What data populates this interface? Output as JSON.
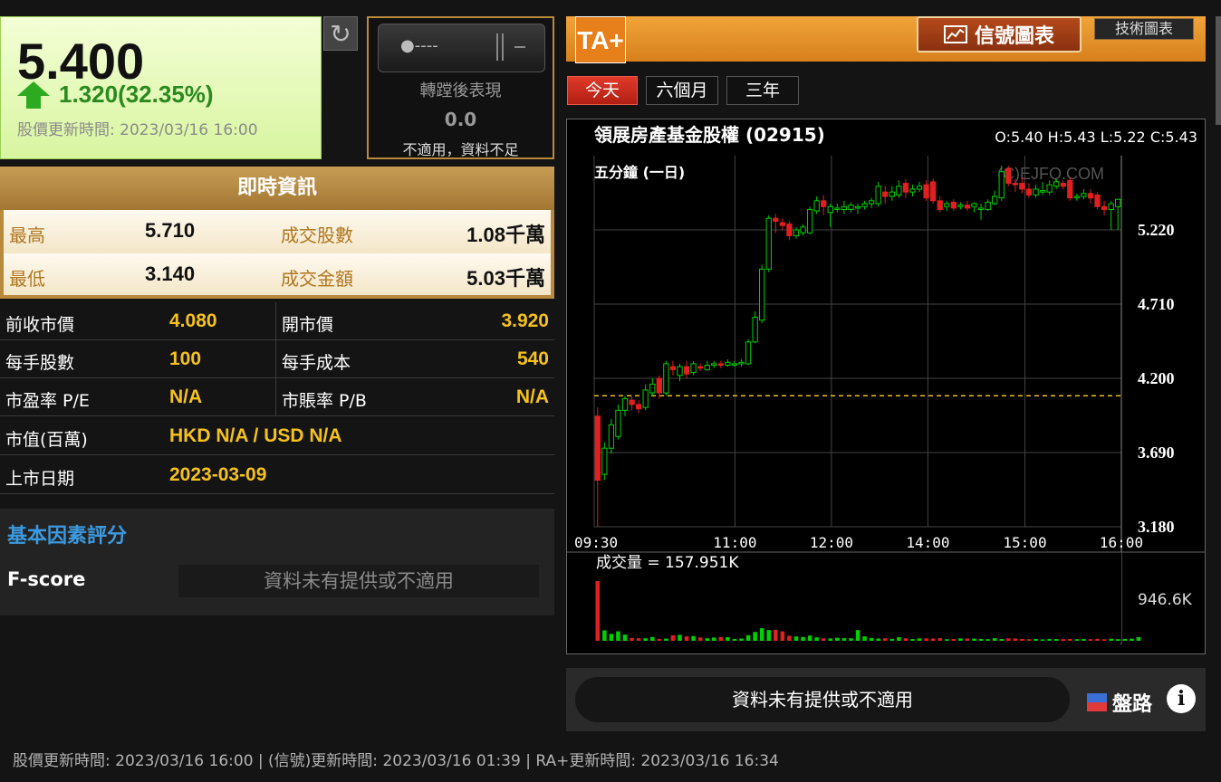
{
  "quote": {
    "price": "5.400",
    "change": "1.320(32.35%)",
    "price_time": "股價更新時間: 2023/03/16 16:00"
  },
  "split": {
    "toggle_label": "●----",
    "label": "轉蹚後表現",
    "value": "0.0",
    "note": "不適用，資料不足"
  },
  "live": {
    "title": "即時資訊",
    "high_label": "最高",
    "high": "5.710",
    "volume_label": "成交股數",
    "volume": "1.08千萬",
    "low_label": "最低",
    "low": "3.140",
    "turnover_label": "成交金額",
    "turnover": "5.03千萬"
  },
  "stats": {
    "prev_close_label": "前收市價",
    "prev_close": "4.080",
    "open_label": "開市價",
    "open": "3.920",
    "lot_label": "每手股數",
    "lot": "100",
    "lot_cost_label": "每手成本",
    "lot_cost": "540",
    "pe_label": "市盈率 P/E",
    "pe": "N/A",
    "pb_label": "市賬率 P/B",
    "pb": "N/A",
    "mcap_label": "市值(百萬)",
    "mcap": "HKD N/A / USD N/A",
    "listing_label": "上市日期",
    "listing": "2023-03-09"
  },
  "fundamental": {
    "title": "基本因素評分",
    "fscore_label": "F-score",
    "fscore_value": "資料未有提供或不適用"
  },
  "ta": {
    "logo": "TA+",
    "signal_button": "信號圖表",
    "tech_button": "技術圖表",
    "tabs": [
      "今天",
      "六個月",
      "三年"
    ]
  },
  "chart_data": {
    "type": "candlestick",
    "title": "領展房產基金股權 (02915)",
    "ohlc_label": "O:5.40 H:5.43 L:5.22 C:5.43",
    "subtitle": "五分鐘 (一日)",
    "watermark": "(C)EJFQ.COM",
    "ylim": [
      3.18,
      5.73
    ],
    "yticks": [
      "5.220",
      "4.710",
      "4.200",
      "3.690",
      "3.180"
    ],
    "xticks": [
      "09:30",
      "11:00",
      "12:00",
      "14:00",
      "15:00",
      "16:00"
    ],
    "prev_close_line": 4.08,
    "candles": [
      {
        "o": 3.94,
        "c": 3.5,
        "h": 4.0,
        "l": 3.18
      },
      {
        "o": 3.54,
        "c": 3.72,
        "h": 3.76,
        "l": 3.5
      },
      {
        "o": 3.72,
        "c": 3.88,
        "h": 3.92,
        "l": 3.68
      },
      {
        "o": 3.8,
        "c": 3.98,
        "h": 4.02,
        "l": 3.78
      },
      {
        "o": 3.98,
        "c": 4.06,
        "h": 4.08,
        "l": 3.94
      },
      {
        "o": 4.05,
        "c": 4.02,
        "h": 4.08,
        "l": 3.98
      },
      {
        "o": 4.02,
        "c": 3.99,
        "h": 4.05,
        "l": 3.96
      },
      {
        "o": 4.0,
        "c": 4.12,
        "h": 4.16,
        "l": 3.98
      },
      {
        "o": 4.1,
        "c": 4.16,
        "h": 4.2,
        "l": 4.08
      },
      {
        "o": 4.2,
        "c": 4.1,
        "h": 4.22,
        "l": 4.06
      },
      {
        "o": 4.1,
        "c": 4.3,
        "h": 4.32,
        "l": 4.08
      },
      {
        "o": 4.28,
        "c": 4.26,
        "h": 4.32,
        "l": 4.22
      },
      {
        "o": 4.22,
        "c": 4.28,
        "h": 4.3,
        "l": 4.18
      },
      {
        "o": 4.28,
        "c": 4.23,
        "h": 4.32,
        "l": 4.2
      },
      {
        "o": 4.24,
        "c": 4.3,
        "h": 4.32,
        "l": 4.22
      },
      {
        "o": 4.28,
        "c": 4.27,
        "h": 4.3,
        "l": 4.25
      },
      {
        "o": 4.26,
        "c": 4.29,
        "h": 4.32,
        "l": 4.25
      },
      {
        "o": 4.29,
        "c": 4.3,
        "h": 4.32,
        "l": 4.27
      },
      {
        "o": 4.3,
        "c": 4.29,
        "h": 4.32,
        "l": 4.27
      },
      {
        "o": 4.29,
        "c": 4.31,
        "h": 4.33,
        "l": 4.28
      },
      {
        "o": 4.3,
        "c": 4.3,
        "h": 4.32,
        "l": 4.28
      },
      {
        "o": 4.3,
        "c": 4.31,
        "h": 4.33,
        "l": 4.28
      },
      {
        "o": 4.3,
        "c": 4.45,
        "h": 4.47,
        "l": 4.29
      },
      {
        "o": 4.45,
        "c": 4.62,
        "h": 4.66,
        "l": 4.44
      },
      {
        "o": 4.6,
        "c": 4.95,
        "h": 4.98,
        "l": 4.58
      },
      {
        "o": 4.95,
        "c": 5.3,
        "h": 5.32,
        "l": 4.93
      },
      {
        "o": 5.3,
        "c": 5.28,
        "h": 5.33,
        "l": 5.2
      },
      {
        "o": 5.27,
        "c": 5.25,
        "h": 5.3,
        "l": 5.22
      },
      {
        "o": 5.26,
        "c": 5.18,
        "h": 5.28,
        "l": 5.15
      },
      {
        "o": 5.18,
        "c": 5.22,
        "h": 5.24,
        "l": 5.16
      },
      {
        "o": 5.2,
        "c": 5.24,
        "h": 5.26,
        "l": 5.18
      },
      {
        "o": 5.2,
        "c": 5.36,
        "h": 5.38,
        "l": 5.19
      },
      {
        "o": 5.35,
        "c": 5.42,
        "h": 5.45,
        "l": 5.33
      },
      {
        "o": 5.42,
        "c": 5.38,
        "h": 5.46,
        "l": 5.32
      },
      {
        "o": 5.34,
        "c": 5.38,
        "h": 5.4,
        "l": 5.24
      },
      {
        "o": 5.36,
        "c": 5.37,
        "h": 5.4,
        "l": 5.34
      },
      {
        "o": 5.36,
        "c": 5.38,
        "h": 5.42,
        "l": 5.33
      },
      {
        "o": 5.36,
        "c": 5.39,
        "h": 5.41,
        "l": 5.34
      },
      {
        "o": 5.37,
        "c": 5.38,
        "h": 5.4,
        "l": 5.33
      },
      {
        "o": 5.38,
        "c": 5.4,
        "h": 5.42,
        "l": 5.36
      },
      {
        "o": 5.4,
        "c": 5.42,
        "h": 5.44,
        "l": 5.37
      },
      {
        "o": 5.4,
        "c": 5.52,
        "h": 5.55,
        "l": 5.38
      },
      {
        "o": 5.48,
        "c": 5.45,
        "h": 5.52,
        "l": 5.4
      },
      {
        "o": 5.45,
        "c": 5.48,
        "h": 5.52,
        "l": 5.42
      },
      {
        "o": 5.46,
        "c": 5.52,
        "h": 5.56,
        "l": 5.44
      },
      {
        "o": 5.54,
        "c": 5.48,
        "h": 5.57,
        "l": 5.44
      },
      {
        "o": 5.48,
        "c": 5.5,
        "h": 5.53,
        "l": 5.45
      },
      {
        "o": 5.5,
        "c": 5.52,
        "h": 5.55,
        "l": 5.48
      },
      {
        "o": 5.53,
        "c": 5.44,
        "h": 5.56,
        "l": 5.42
      },
      {
        "o": 5.55,
        "c": 5.42,
        "h": 5.57,
        "l": 5.4
      },
      {
        "o": 5.42,
        "c": 5.36,
        "h": 5.45,
        "l": 5.34
      },
      {
        "o": 5.38,
        "c": 5.4,
        "h": 5.42,
        "l": 5.35
      },
      {
        "o": 5.41,
        "c": 5.37,
        "h": 5.43,
        "l": 5.35
      },
      {
        "o": 5.38,
        "c": 5.39,
        "h": 5.41,
        "l": 5.36
      },
      {
        "o": 5.39,
        "c": 5.37,
        "h": 5.42,
        "l": 5.35
      },
      {
        "o": 5.38,
        "c": 5.4,
        "h": 5.41,
        "l": 5.34
      },
      {
        "o": 5.36,
        "c": 5.37,
        "h": 5.4,
        "l": 5.29
      },
      {
        "o": 5.36,
        "c": 5.41,
        "h": 5.43,
        "l": 5.35
      },
      {
        "o": 5.4,
        "c": 5.45,
        "h": 5.49,
        "l": 5.39
      },
      {
        "o": 5.44,
        "c": 5.62,
        "h": 5.66,
        "l": 5.42
      },
      {
        "o": 5.64,
        "c": 5.54,
        "h": 5.66,
        "l": 5.52
      },
      {
        "o": 5.54,
        "c": 5.53,
        "h": 5.57,
        "l": 5.48
      },
      {
        "o": 5.54,
        "c": 5.5,
        "h": 5.58,
        "l": 5.47
      },
      {
        "o": 5.5,
        "c": 5.46,
        "h": 5.54,
        "l": 5.44
      },
      {
        "o": 5.46,
        "c": 5.5,
        "h": 5.53,
        "l": 5.44
      },
      {
        "o": 5.48,
        "c": 5.49,
        "h": 5.55,
        "l": 5.46
      },
      {
        "o": 5.48,
        "c": 5.53,
        "h": 5.56,
        "l": 5.46
      },
      {
        "o": 5.52,
        "c": 5.55,
        "h": 5.57,
        "l": 5.5
      },
      {
        "o": 5.54,
        "c": 5.52,
        "h": 5.56,
        "l": 5.5
      },
      {
        "o": 5.56,
        "c": 5.44,
        "h": 5.58,
        "l": 5.42
      },
      {
        "o": 5.44,
        "c": 5.45,
        "h": 5.47,
        "l": 5.42
      },
      {
        "o": 5.45,
        "c": 5.47,
        "h": 5.5,
        "l": 5.43
      },
      {
        "o": 5.47,
        "c": 5.44,
        "h": 5.5,
        "l": 5.4
      },
      {
        "o": 5.46,
        "c": 5.38,
        "h": 5.48,
        "l": 5.36
      },
      {
        "o": 5.38,
        "c": 5.36,
        "h": 5.42,
        "l": 5.32
      },
      {
        "o": 5.36,
        "c": 5.4,
        "h": 5.42,
        "l": 5.22
      },
      {
        "o": 5.38,
        "c": 5.43,
        "h": 5.43,
        "l": 5.22
      }
    ],
    "volume_label": "成交量 = 157.951K",
    "volume_max_label": "946.6K",
    "volume_max": 946.6,
    "volumes": [
      946,
      165,
      110,
      150,
      98,
      45,
      40,
      40,
      60,
      30,
      35,
      88,
      95,
      70,
      75,
      52,
      40,
      52,
      60,
      58,
      30,
      36,
      90,
      140,
      200,
      170,
      175,
      150,
      80,
      70,
      60,
      82,
      55,
      38,
      38,
      48,
      42,
      40,
      170,
      70,
      45,
      36,
      40,
      30,
      58,
      40,
      28,
      38,
      38,
      36,
      42,
      25,
      28,
      38,
      36,
      35,
      30,
      26,
      42,
      28,
      38,
      36,
      30,
      26,
      30,
      22,
      30,
      28,
      26,
      30,
      26,
      28,
      26,
      32,
      24,
      32,
      26,
      30,
      34,
      58
    ]
  },
  "bottom": {
    "message": "資料未有提供或不適用",
    "pankou_label": "盤路",
    "info_icon_text": "i"
  },
  "footer": "股價更新時間: 2023/03/16 16:00  |  (信號)更新時間: 2023/03/16 01:39  |  RA+更新時間: 2023/03/16 16:34",
  "colors": {
    "up": "#00d000",
    "down": "#e02020",
    "accent": "#f5c21d",
    "gold": "#b98a3c"
  }
}
